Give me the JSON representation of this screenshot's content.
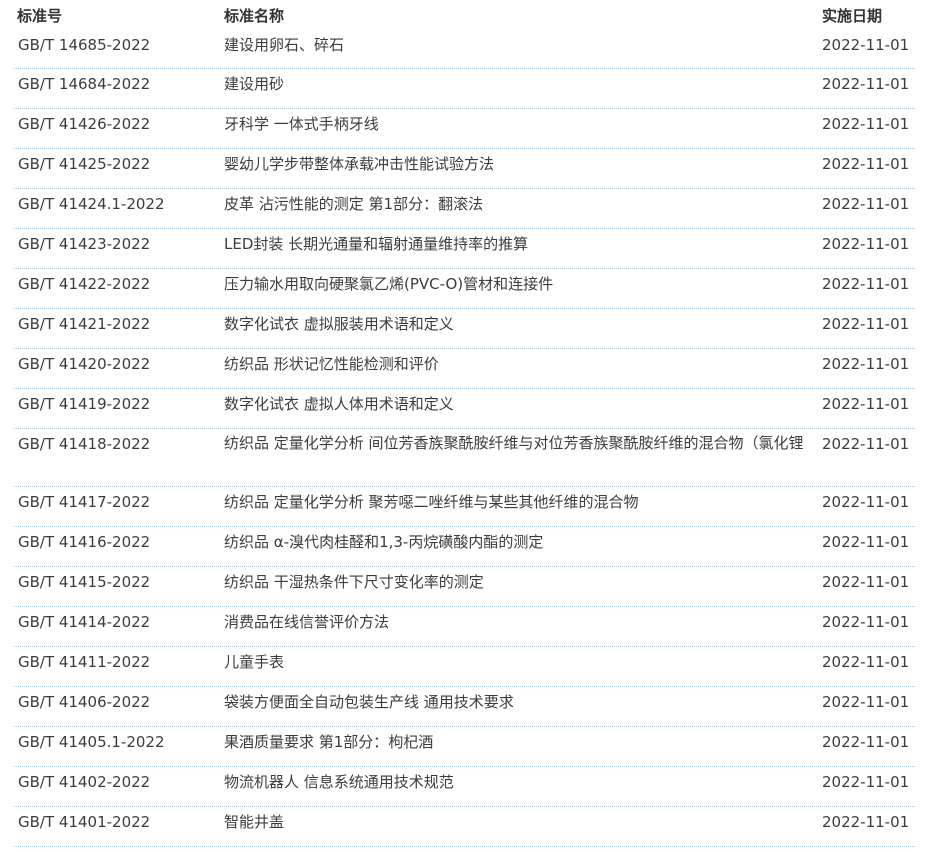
{
  "table": {
    "headers": {
      "code": "标准号",
      "name": "标准名称",
      "date": "实施日期"
    },
    "rows": [
      {
        "code": "GB/T 14685-2022",
        "name": "建设用卵石、碎石",
        "date": "2022-11-01"
      },
      {
        "code": "GB/T 14684-2022",
        "name": "建设用砂",
        "date": "2022-11-01"
      },
      {
        "code": "GB/T 41426-2022",
        "name": "牙科学 一体式手柄牙线",
        "date": "2022-11-01"
      },
      {
        "code": "GB/T 41425-2022",
        "name": "婴幼儿学步带整体承载冲击性能试验方法",
        "date": "2022-11-01"
      },
      {
        "code": "GB/T 41424.1-2022",
        "name": "皮革 沾污性能的测定 第1部分：翻滚法",
        "date": "2022-11-01"
      },
      {
        "code": "GB/T 41423-2022",
        "name": "LED封装 长期光通量和辐射通量维持率的推算",
        "date": "2022-11-01"
      },
      {
        "code": "GB/T 41422-2022",
        "name": "压力输水用取向硬聚氯乙烯(PVC-O)管材和连接件",
        "date": "2022-11-01"
      },
      {
        "code": "GB/T 41421-2022",
        "name": "数字化试衣 虚拟服装用术语和定义",
        "date": "2022-11-01"
      },
      {
        "code": "GB/T 41420-2022",
        "name": "纺织品 形状记忆性能检测和评价",
        "date": "2022-11-01"
      },
      {
        "code": "GB/T 41419-2022",
        "name": "数字化试衣 虚拟人体用术语和定义",
        "date": "2022-11-01"
      },
      {
        "code": "GB/T 41418-2022",
        "name": "纺织品 定量化学分析 间位芳香族聚酰胺纤维与对位芳香族聚酰胺纤维的混合物（氯化锂",
        "date": "2022-11-01"
      },
      {
        "code": "GB/T 41417-2022",
        "name": "纺织品 定量化学分析 聚芳噁二唑纤维与某些其他纤维的混合物",
        "date": "2022-11-01"
      },
      {
        "code": "GB/T 41416-2022",
        "name": "纺织品 α-溴代肉桂醛和1,3-丙烷磺酸内酯的测定",
        "date": "2022-11-01"
      },
      {
        "code": "GB/T 41415-2022",
        "name": "纺织品 干湿热条件下尺寸变化率的测定",
        "date": "2022-11-01"
      },
      {
        "code": "GB/T 41414-2022",
        "name": "消费品在线信誉评价方法",
        "date": "2022-11-01"
      },
      {
        "code": "GB/T 41411-2022",
        "name": "儿童手表",
        "date": "2022-11-01"
      },
      {
        "code": "GB/T 41406-2022",
        "name": "袋装方便面全自动包装生产线 通用技术要求",
        "date": "2022-11-01"
      },
      {
        "code": "GB/T 41405.1-2022",
        "name": "果酒质量要求 第1部分：枸杞酒",
        "date": "2022-11-01"
      },
      {
        "code": "GB/T 41402-2022",
        "name": "物流机器人 信息系统通用技术规范",
        "date": "2022-11-01"
      },
      {
        "code": "GB/T 41401-2022",
        "name": "智能井盖",
        "date": "2022-11-01"
      }
    ]
  }
}
